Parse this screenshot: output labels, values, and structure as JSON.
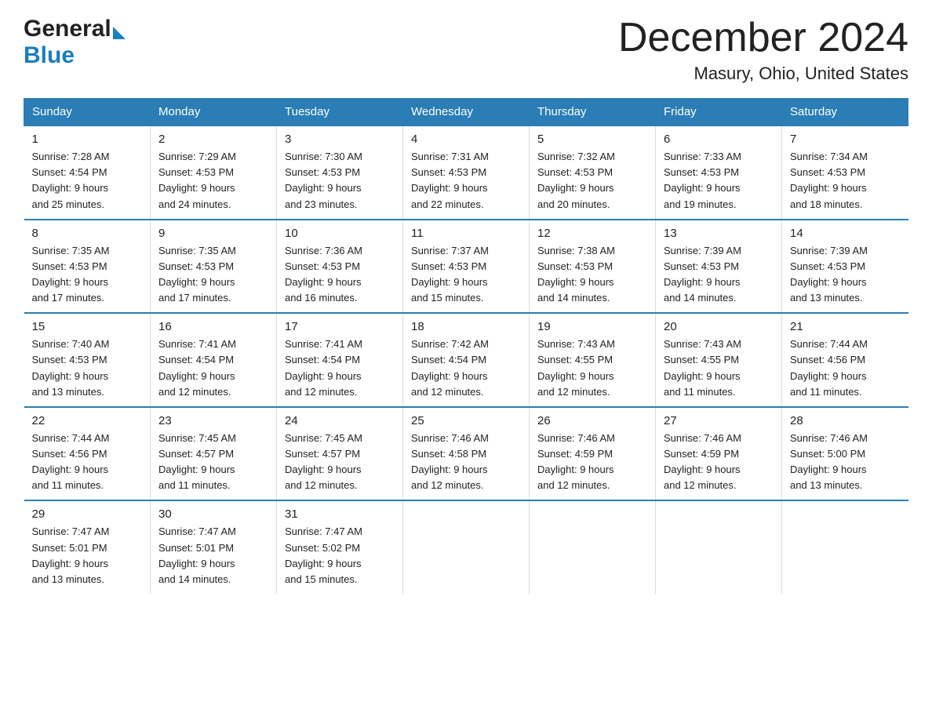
{
  "logo": {
    "general": "General",
    "blue": "Blue"
  },
  "title": "December 2024",
  "subtitle": "Masury, Ohio, United States",
  "days_of_week": [
    "Sunday",
    "Monday",
    "Tuesday",
    "Wednesday",
    "Thursday",
    "Friday",
    "Saturday"
  ],
  "weeks": [
    [
      {
        "day": "1",
        "sunrise": "7:28 AM",
        "sunset": "4:54 PM",
        "daylight": "9 hours and 25 minutes."
      },
      {
        "day": "2",
        "sunrise": "7:29 AM",
        "sunset": "4:53 PM",
        "daylight": "9 hours and 24 minutes."
      },
      {
        "day": "3",
        "sunrise": "7:30 AM",
        "sunset": "4:53 PM",
        "daylight": "9 hours and 23 minutes."
      },
      {
        "day": "4",
        "sunrise": "7:31 AM",
        "sunset": "4:53 PM",
        "daylight": "9 hours and 22 minutes."
      },
      {
        "day": "5",
        "sunrise": "7:32 AM",
        "sunset": "4:53 PM",
        "daylight": "9 hours and 20 minutes."
      },
      {
        "day": "6",
        "sunrise": "7:33 AM",
        "sunset": "4:53 PM",
        "daylight": "9 hours and 19 minutes."
      },
      {
        "day": "7",
        "sunrise": "7:34 AM",
        "sunset": "4:53 PM",
        "daylight": "9 hours and 18 minutes."
      }
    ],
    [
      {
        "day": "8",
        "sunrise": "7:35 AM",
        "sunset": "4:53 PM",
        "daylight": "9 hours and 17 minutes."
      },
      {
        "day": "9",
        "sunrise": "7:35 AM",
        "sunset": "4:53 PM",
        "daylight": "9 hours and 17 minutes."
      },
      {
        "day": "10",
        "sunrise": "7:36 AM",
        "sunset": "4:53 PM",
        "daylight": "9 hours and 16 minutes."
      },
      {
        "day": "11",
        "sunrise": "7:37 AM",
        "sunset": "4:53 PM",
        "daylight": "9 hours and 15 minutes."
      },
      {
        "day": "12",
        "sunrise": "7:38 AM",
        "sunset": "4:53 PM",
        "daylight": "9 hours and 14 minutes."
      },
      {
        "day": "13",
        "sunrise": "7:39 AM",
        "sunset": "4:53 PM",
        "daylight": "9 hours and 14 minutes."
      },
      {
        "day": "14",
        "sunrise": "7:39 AM",
        "sunset": "4:53 PM",
        "daylight": "9 hours and 13 minutes."
      }
    ],
    [
      {
        "day": "15",
        "sunrise": "7:40 AM",
        "sunset": "4:53 PM",
        "daylight": "9 hours and 13 minutes."
      },
      {
        "day": "16",
        "sunrise": "7:41 AM",
        "sunset": "4:54 PM",
        "daylight": "9 hours and 12 minutes."
      },
      {
        "day": "17",
        "sunrise": "7:41 AM",
        "sunset": "4:54 PM",
        "daylight": "9 hours and 12 minutes."
      },
      {
        "day": "18",
        "sunrise": "7:42 AM",
        "sunset": "4:54 PM",
        "daylight": "9 hours and 12 minutes."
      },
      {
        "day": "19",
        "sunrise": "7:43 AM",
        "sunset": "4:55 PM",
        "daylight": "9 hours and 12 minutes."
      },
      {
        "day": "20",
        "sunrise": "7:43 AM",
        "sunset": "4:55 PM",
        "daylight": "9 hours and 11 minutes."
      },
      {
        "day": "21",
        "sunrise": "7:44 AM",
        "sunset": "4:56 PM",
        "daylight": "9 hours and 11 minutes."
      }
    ],
    [
      {
        "day": "22",
        "sunrise": "7:44 AM",
        "sunset": "4:56 PM",
        "daylight": "9 hours and 11 minutes."
      },
      {
        "day": "23",
        "sunrise": "7:45 AM",
        "sunset": "4:57 PM",
        "daylight": "9 hours and 11 minutes."
      },
      {
        "day": "24",
        "sunrise": "7:45 AM",
        "sunset": "4:57 PM",
        "daylight": "9 hours and 12 minutes."
      },
      {
        "day": "25",
        "sunrise": "7:46 AM",
        "sunset": "4:58 PM",
        "daylight": "9 hours and 12 minutes."
      },
      {
        "day": "26",
        "sunrise": "7:46 AM",
        "sunset": "4:59 PM",
        "daylight": "9 hours and 12 minutes."
      },
      {
        "day": "27",
        "sunrise": "7:46 AM",
        "sunset": "4:59 PM",
        "daylight": "9 hours and 12 minutes."
      },
      {
        "day": "28",
        "sunrise": "7:46 AM",
        "sunset": "5:00 PM",
        "daylight": "9 hours and 13 minutes."
      }
    ],
    [
      {
        "day": "29",
        "sunrise": "7:47 AM",
        "sunset": "5:01 PM",
        "daylight": "9 hours and 13 minutes."
      },
      {
        "day": "30",
        "sunrise": "7:47 AM",
        "sunset": "5:01 PM",
        "daylight": "9 hours and 14 minutes."
      },
      {
        "day": "31",
        "sunrise": "7:47 AM",
        "sunset": "5:02 PM",
        "daylight": "9 hours and 15 minutes."
      },
      null,
      null,
      null,
      null
    ]
  ],
  "labels": {
    "sunrise": "Sunrise:",
    "sunset": "Sunset:",
    "daylight": "Daylight:"
  }
}
